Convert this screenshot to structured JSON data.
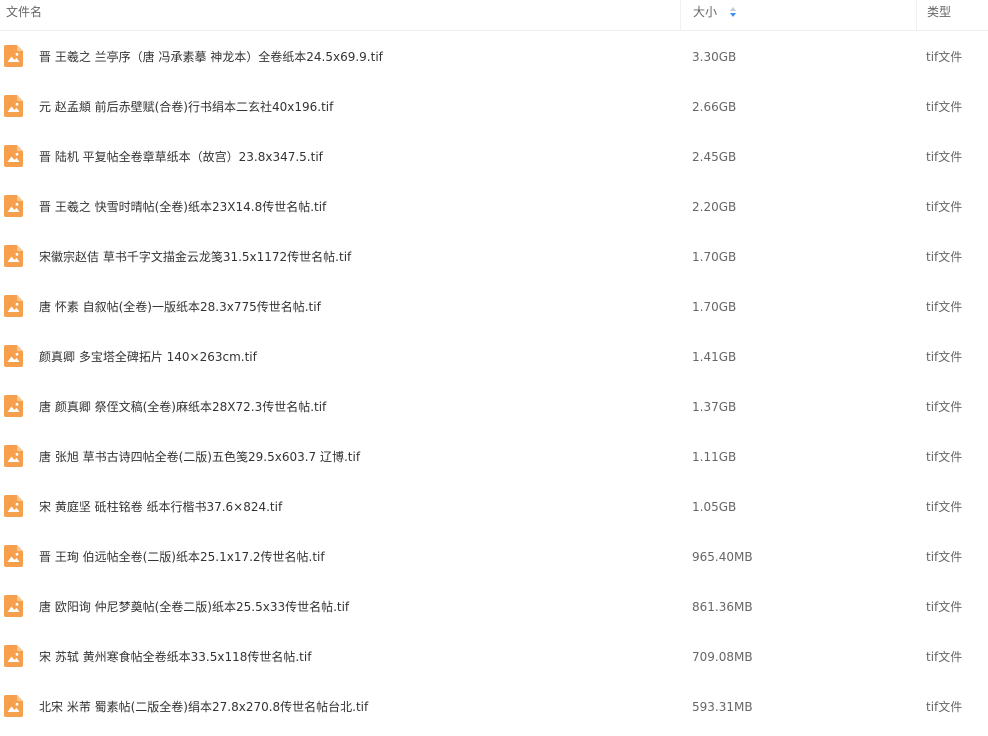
{
  "columns": {
    "name": "文件名",
    "size": "大小",
    "type": "类型"
  },
  "colors": {
    "icon_orange": "#f6a04d",
    "sort_active": "#3b8cff"
  },
  "files": [
    {
      "name": "晋 王羲之 兰亭序（唐 冯承素摹 神龙本）全卷纸本24.5x69.9.tif",
      "size": "3.30GB",
      "type": "tif文件",
      "icon": "image-file-icon"
    },
    {
      "name": "元 赵孟頫 前后赤壁赋(合卷)行书绢本二玄社40x196.tif",
      "size": "2.66GB",
      "type": "tif文件",
      "icon": "image-file-icon"
    },
    {
      "name": "晋 陆机 平复帖全卷章草纸本（故宫）23.8x347.5.tif",
      "size": "2.45GB",
      "type": "tif文件",
      "icon": "image-file-icon"
    },
    {
      "name": "晋 王羲之 快雪时晴帖(全卷)纸本23X14.8传世名帖.tif",
      "size": "2.20GB",
      "type": "tif文件",
      "icon": "image-file-icon"
    },
    {
      "name": "宋徽宗赵佶 草书千字文描金云龙笺31.5x1172传世名帖.tif",
      "size": "1.70GB",
      "type": "tif文件",
      "icon": "image-file-icon"
    },
    {
      "name": "唐 怀素 自叙帖(全卷)一版纸本28.3x775传世名帖.tif",
      "size": "1.70GB",
      "type": "tif文件",
      "icon": "image-file-icon"
    },
    {
      "name": "颜真卿 多宝塔全碑拓片 140×263cm.tif",
      "size": "1.41GB",
      "type": "tif文件",
      "icon": "image-file-icon"
    },
    {
      "name": "唐 颜真卿 祭侄文稿(全卷)麻纸本28X72.3传世名帖.tif",
      "size": "1.37GB",
      "type": "tif文件",
      "icon": "image-file-icon"
    },
    {
      "name": "唐 张旭 草书古诗四帖全卷(二版)五色笺29.5x603.7 辽博.tif",
      "size": "1.11GB",
      "type": "tif文件",
      "icon": "image-file-icon"
    },
    {
      "name": "宋 黄庭坚 砥柱铭卷 纸本行楷书37.6×824.tif",
      "size": "1.05GB",
      "type": "tif文件",
      "icon": "image-file-icon"
    },
    {
      "name": "晋 王珣 伯远帖全卷(二版)纸本25.1x17.2传世名帖.tif",
      "size": "965.40MB",
      "type": "tif文件",
      "icon": "image-file-icon"
    },
    {
      "name": "唐 欧阳询 仲尼梦奠帖(全卷二版)纸本25.5x33传世名帖.tif",
      "size": "861.36MB",
      "type": "tif文件",
      "icon": "image-file-icon"
    },
    {
      "name": "宋 苏轼 黄州寒食帖全卷纸本33.5x118传世名帖.tif",
      "size": "709.08MB",
      "type": "tif文件",
      "icon": "image-file-icon"
    },
    {
      "name": "北宋 米芾 蜀素帖(二版全卷)绢本27.8x270.8传世名帖台北.tif",
      "size": "593.31MB",
      "type": "tif文件",
      "icon": "image-file-icon"
    }
  ]
}
